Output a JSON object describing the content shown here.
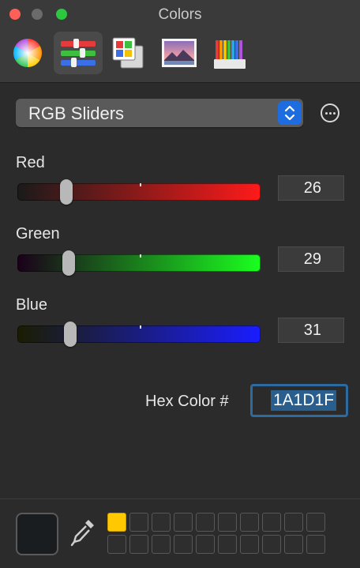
{
  "window": {
    "title": "Colors"
  },
  "toolbar": {
    "buttons": [
      {
        "name": "color-wheel-icon",
        "active": false
      },
      {
        "name": "color-sliders-icon",
        "active": true
      },
      {
        "name": "color-palettes-icon",
        "active": false
      },
      {
        "name": "image-palettes-icon",
        "active": false
      },
      {
        "name": "pencils-icon",
        "active": false
      }
    ]
  },
  "mode_popup": {
    "label": "RGB Sliders"
  },
  "sliders": [
    {
      "label": "Red",
      "value": "26",
      "level": 26,
      "max": 255,
      "start_color": "#1a1a1a",
      "end_color": "#ff1a1a"
    },
    {
      "label": "Green",
      "value": "29",
      "level": 29,
      "max": 255,
      "start_color": "#1a001a",
      "end_color": "#1aff1f"
    },
    {
      "label": "Blue",
      "value": "31",
      "level": 31,
      "max": 255,
      "start_color": "#1a1d00",
      "end_color": "#1a1dff"
    }
  ],
  "hex": {
    "label": "Hex Color #",
    "value": "1A1D1F"
  },
  "current_color": "#1a1d1f",
  "saved_swatches": {
    "first_color": "#ffc800",
    "count": 20
  },
  "colors": {
    "accent": "#1e6de0",
    "selection": "#2a5e8c"
  }
}
